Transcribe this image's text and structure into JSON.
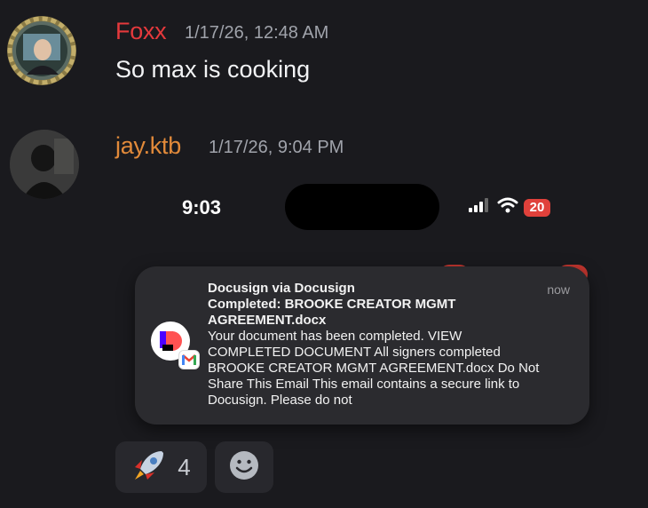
{
  "messages": [
    {
      "author": "Foxx",
      "author_color": "#e5393c",
      "timestamp": "1/17/26, 12:48 AM",
      "content": "So max is cooking"
    },
    {
      "author": "jay.ktb",
      "author_color": "#e28a3a",
      "timestamp": "1/17/26, 9:04 PM"
    }
  ],
  "attachment": {
    "phone_time": "9:03",
    "battery": "20",
    "notification": {
      "sender": "Docusign via Docusign",
      "subject_line1": "Completed: BROOKE CREATOR MGMT",
      "subject_line2": "AGREEMENT.docx",
      "body_line1": "Your document has been completed. VIEW",
      "body_line2": "COMPLETED DOCUMENT All signers completed",
      "body_line3": "BROOKE CREATOR MGMT AGREEMENT.docx Do Not",
      "body_line4": "Share This Email This email contains a secure link to",
      "body_line5": "Docusign. Please do not",
      "time": "now",
      "icon": "docusign-icon",
      "badge_icon": "gmail-icon"
    }
  },
  "reactions": [
    {
      "emoji": "rocket-icon",
      "count": "4"
    },
    {
      "emoji": "add-reaction-icon"
    }
  ]
}
